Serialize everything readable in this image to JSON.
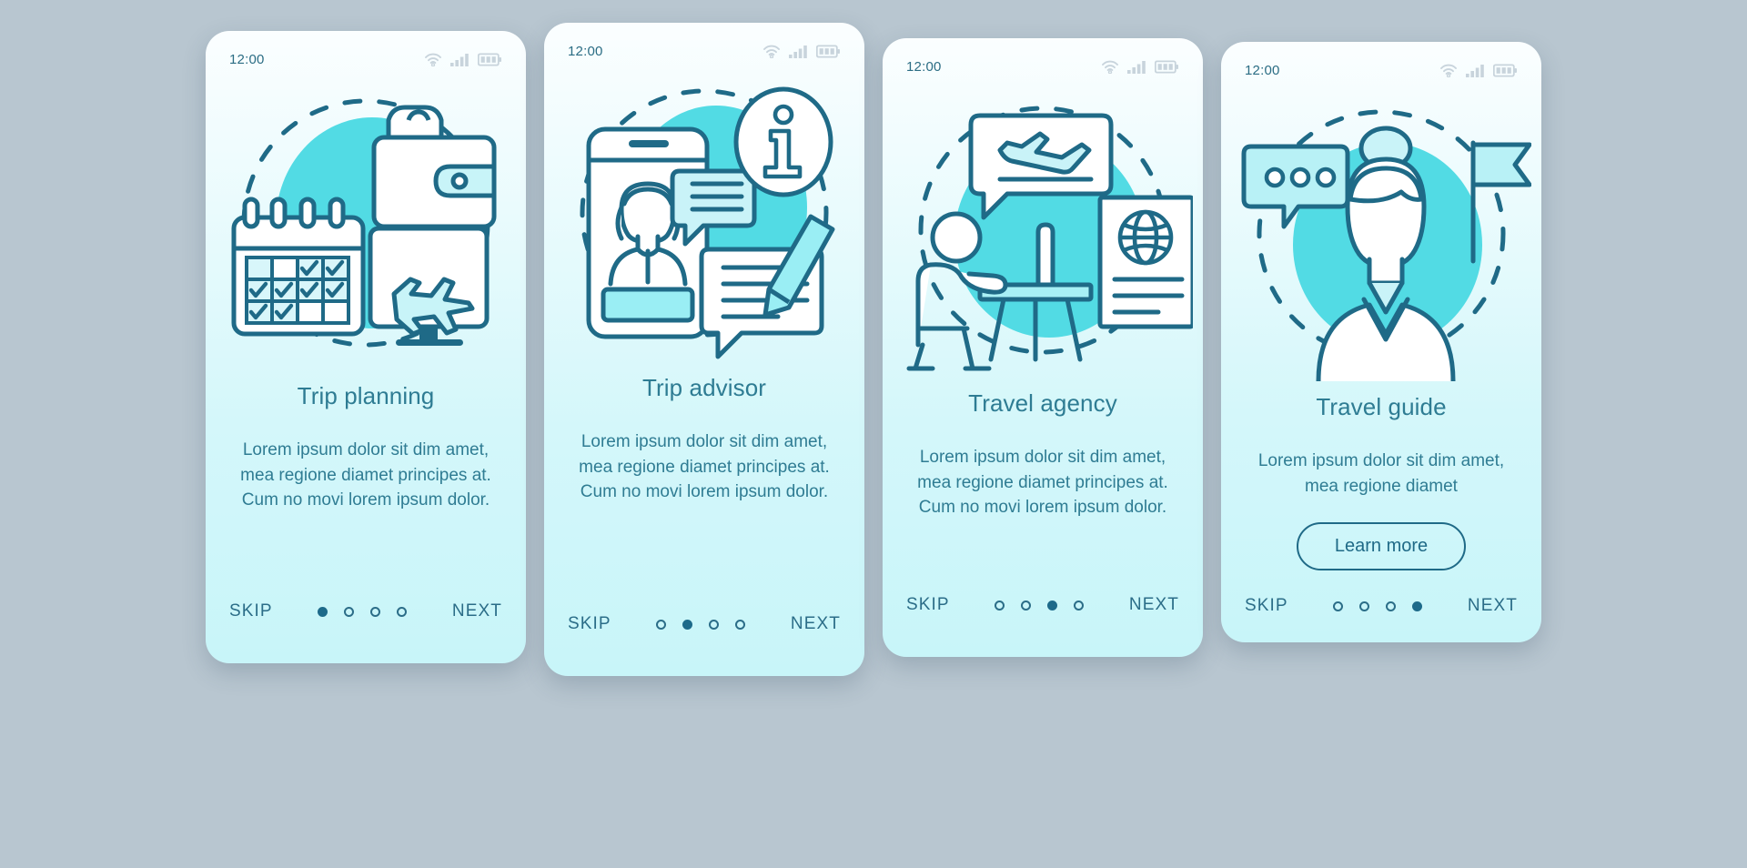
{
  "theme": {
    "page_background": "#b8c6d0",
    "card_gradient_top": "#fbfeff",
    "card_gradient_bottom": "#c8f5f9",
    "accent_teal": "#52dbe4",
    "stroke_blue": "#1f6a87",
    "text_blue": "#2e7c93",
    "status_icon_gray": "#c8d4dc"
  },
  "screens": [
    {
      "status": {
        "time": "12:00",
        "wifi_icon": "wifi-icon",
        "signal_icon": "signal-bars-icon",
        "battery_icon": "battery-icon"
      },
      "illustration_name": "trip-planning-illustration",
      "title": "Trip planning",
      "description": "Lorem ipsum dolor sit dim amet, mea regione diamet principes at. Cum no movi lorem ipsum dolor.",
      "has_button": false,
      "button_label": "",
      "footer": {
        "skip_label": "SKIP",
        "next_label": "NEXT",
        "dot_count": 4,
        "active_dot": 1
      }
    },
    {
      "status": {
        "time": "12:00",
        "wifi_icon": "wifi-icon",
        "signal_icon": "signal-bars-icon",
        "battery_icon": "battery-icon"
      },
      "illustration_name": "trip-advisor-illustration",
      "title": "Trip advisor",
      "description": "Lorem ipsum dolor sit dim amet, mea regione diamet principes at. Cum no movi lorem ipsum dolor.",
      "has_button": false,
      "button_label": "",
      "footer": {
        "skip_label": "SKIP",
        "next_label": "NEXT",
        "dot_count": 4,
        "active_dot": 2
      }
    },
    {
      "status": {
        "time": "12:00",
        "wifi_icon": "wifi-icon",
        "signal_icon": "signal-bars-icon",
        "battery_icon": "battery-icon"
      },
      "illustration_name": "travel-agency-illustration",
      "title": "Travel agency",
      "description": "Lorem ipsum dolor sit dim amet, mea regione diamet principes at. Cum no movi lorem ipsum dolor.",
      "has_button": false,
      "button_label": "",
      "footer": {
        "skip_label": "SKIP",
        "next_label": "NEXT",
        "dot_count": 4,
        "active_dot": 3
      }
    },
    {
      "status": {
        "time": "12:00",
        "wifi_icon": "wifi-icon",
        "signal_icon": "signal-bars-icon",
        "battery_icon": "battery-icon"
      },
      "illustration_name": "travel-guide-illustration",
      "title": "Travel guide",
      "description": "Lorem ipsum dolor sit dim amet, mea regione diamet",
      "has_button": true,
      "button_label": "Learn more",
      "footer": {
        "skip_label": "SKIP",
        "next_label": "NEXT",
        "dot_count": 4,
        "active_dot": 4
      }
    }
  ]
}
